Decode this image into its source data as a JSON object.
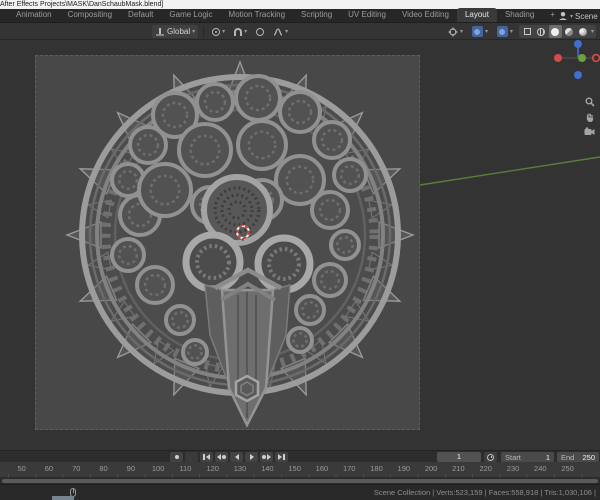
{
  "window": {
    "title": "After Effects Projects\\MASK\\DanSchaubMask.blend]"
  },
  "topbar": {
    "tabs": [
      {
        "label": "Animation"
      },
      {
        "label": "Compositing"
      },
      {
        "label": "Default"
      },
      {
        "label": "Game Logic"
      },
      {
        "label": "Motion Tracking"
      },
      {
        "label": "Scripting"
      },
      {
        "label": "UV Editing"
      },
      {
        "label": "Video Editing"
      },
      {
        "label": "Layout",
        "active": true
      },
      {
        "label": "Shading"
      },
      {
        "label": "+"
      }
    ],
    "scene": {
      "label": "Scene",
      "icon": "scene-head-icon"
    }
  },
  "viewport_header": {
    "orientation_label": "Global",
    "dropdown_glyph": "▾",
    "left_icons": [
      "transform-orientation-icon",
      "pivot-point-icon",
      "snap-magnet-icon",
      "proportional-editing-icon",
      "falloff-curve-icon"
    ],
    "right_icons": [
      "gizmo-dropdown-icon",
      "show-gizmo-icon",
      "show-overlays-icon",
      "xray-toggle-icon",
      "wireframe-shading-icon",
      "solid-shading-icon",
      "material-shading-icon",
      "rendered-shading-icon"
    ],
    "active_shading": "solid"
  },
  "viewport": {
    "nav_icons": [
      "zoom-icon",
      "pan-hand-icon",
      "camera-view-icon"
    ],
    "model": "ornate circular gear mask with central blade",
    "cursor": "3d-cursor"
  },
  "timeline": {
    "playback_icons": [
      "record",
      "jump-to-start",
      "prev-keyframe",
      "play-reverse",
      "play-forward",
      "next-keyframe",
      "jump-to-end"
    ],
    "current_frame": "1",
    "start_label": "Start",
    "start_value": "1",
    "end_label": "End",
    "end_value": "250",
    "ruler": [
      "50",
      "60",
      "70",
      "80",
      "90",
      "100",
      "110",
      "120",
      "130",
      "140",
      "150",
      "160",
      "170",
      "180",
      "190",
      "200",
      "210",
      "220",
      "230",
      "240",
      "250"
    ]
  },
  "statusbar": {
    "stats": "Scene Collection | Verts:523,159 | Faces:558,918 | Tris:1,030,106 |"
  },
  "colors": {
    "header_icon_blue": "#46639b",
    "cursor_red": "#cc3f3a",
    "axis_x_red": "#d84a4a",
    "axis_y_green": "#6aa33c",
    "axis_z_blue": "#3f6fd0",
    "axis_line_green": "#5c7d3a"
  }
}
